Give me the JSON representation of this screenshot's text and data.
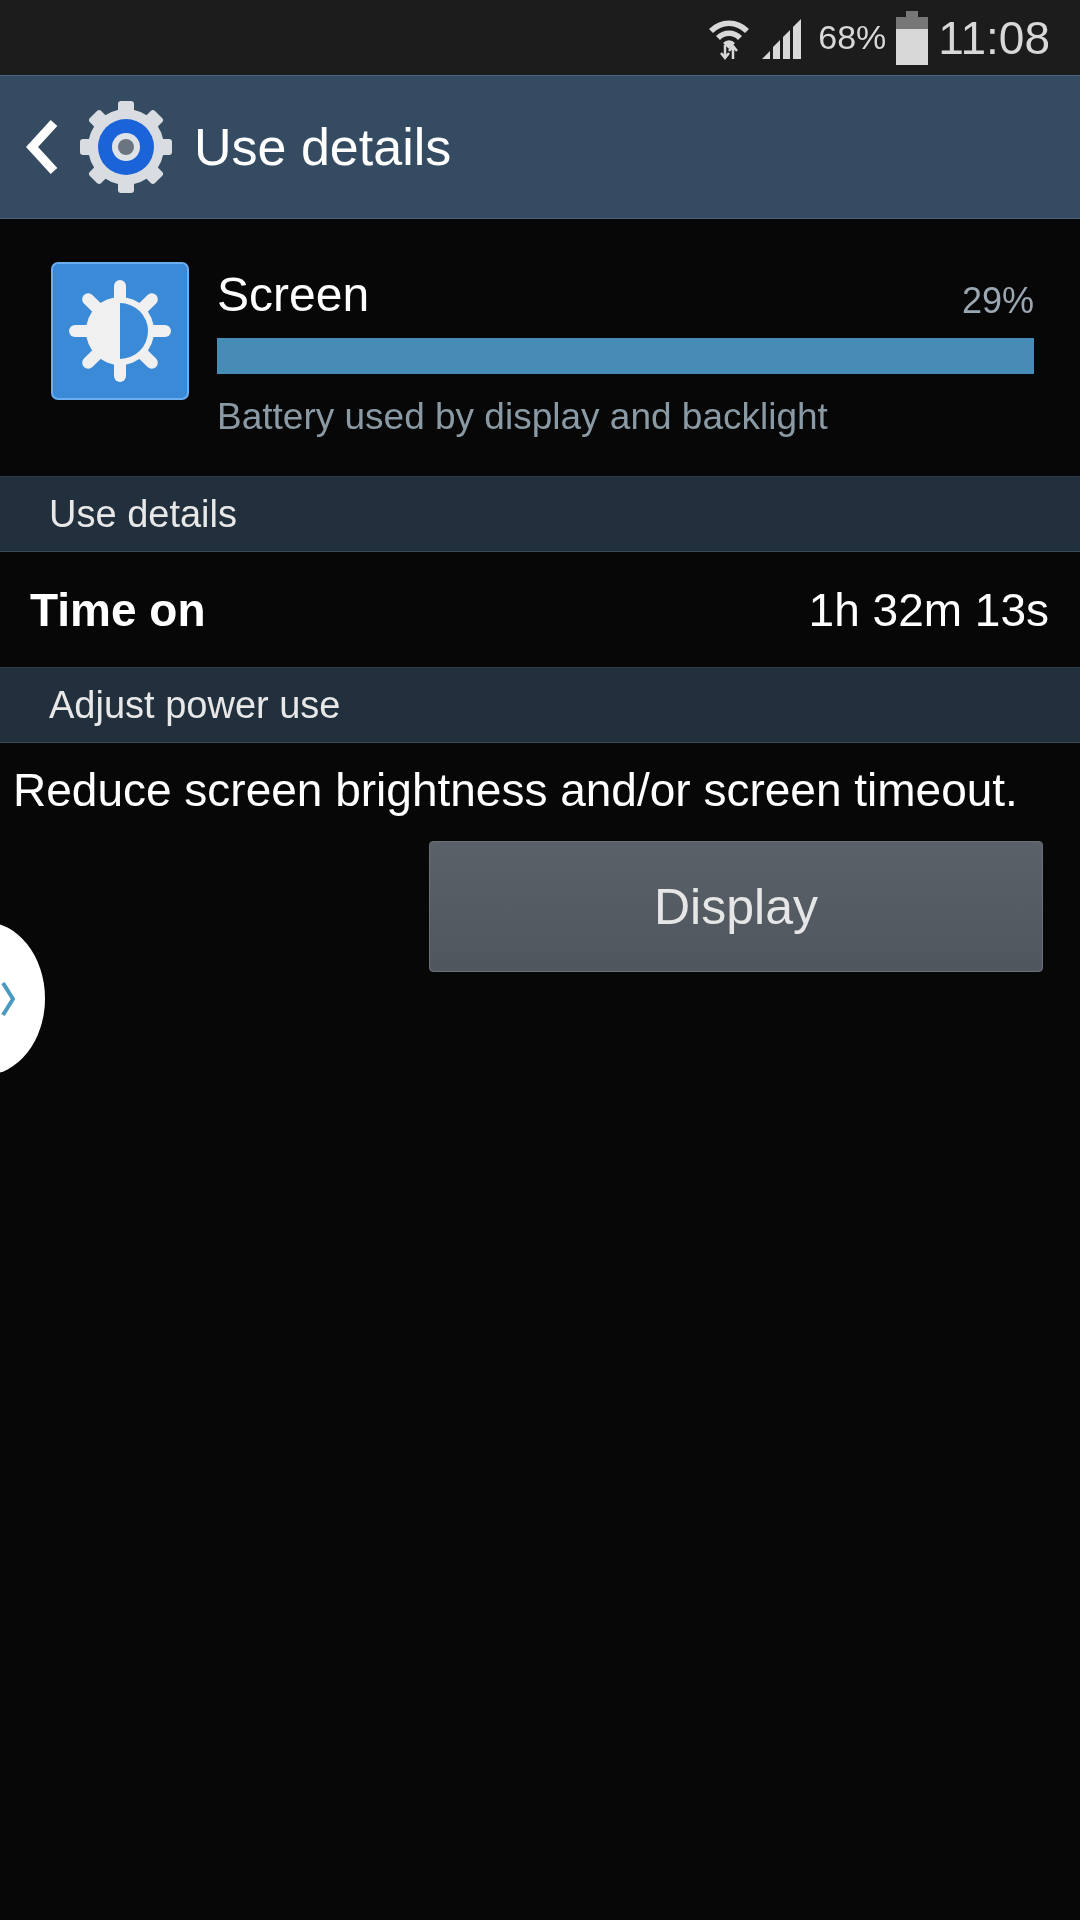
{
  "status_bar": {
    "battery_percent": "68%",
    "time": "11:08"
  },
  "header": {
    "title": "Use details"
  },
  "app_usage": {
    "name": "Screen",
    "percent": "29%",
    "level": 1,
    "description": "Battery used by display and backlight"
  },
  "sections": [
    {
      "title": "Use details",
      "rows": [
        {
          "kind": "detail",
          "label": "Time on",
          "value": "1h 32m 13s"
        }
      ]
    },
    {
      "title": "Adjust power use",
      "rows": [
        {
          "kind": "advice",
          "text": "Reduce screen brightness and/or screen timeout.",
          "button": "Display"
        }
      ]
    }
  ]
}
